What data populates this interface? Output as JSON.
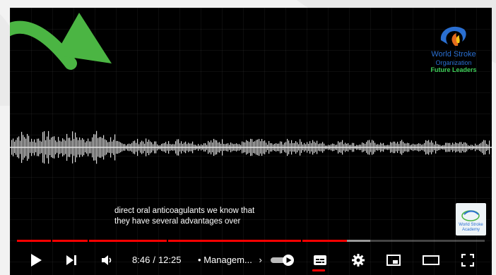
{
  "brand": {
    "accent_red": "#ff0000",
    "arrow_green": "#4bb543",
    "logo_blue": "#2a6fd1",
    "logo_green": "#3fd15a"
  },
  "logo": {
    "line1": "World Stroke",
    "line2": "Organization",
    "line3": "Future Leaders"
  },
  "academy_badge": {
    "line1": "World Stroke",
    "line2": "Academy"
  },
  "captions": {
    "line1": "direct oral anticoagulants we know that",
    "line2": "they have several advantages over"
  },
  "player": {
    "current_time": "8:46",
    "duration": "12:25",
    "separator": "/",
    "chapter_bullet": "•",
    "chapter_title": "Managem...",
    "chapter_arrow": "›",
    "progress_played": 0.705,
    "progress_loaded": 0.755,
    "autoplay_on": true
  },
  "icons": {
    "play": "play-icon",
    "next": "skip-next-icon",
    "volume": "volume-icon",
    "autoplay": "autoplay-toggle",
    "subtitles": "subtitles-icon",
    "settings": "gear-icon",
    "miniplayer": "miniplayer-icon",
    "theater": "theater-mode-icon",
    "fullscreen": "fullscreen-icon"
  }
}
